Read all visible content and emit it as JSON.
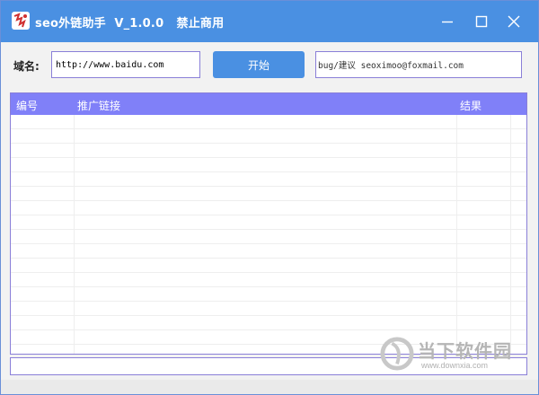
{
  "window": {
    "title": "seo外链助手  V_1.0.0   禁止商用",
    "accent_color": "#4a90e2",
    "controls": [
      "minimize-icon",
      "maximize-icon",
      "close-icon"
    ]
  },
  "form": {
    "domain_label": "域名:",
    "domain_value": "http://www.baidu.com",
    "start_label": "开始",
    "feedback_value": "bug/建议 seoximoo@foxmail.com"
  },
  "table": {
    "header_color": "#8080f8",
    "columns": [
      "编号",
      "推广链接",
      "结果"
    ],
    "rows": []
  },
  "watermark": {
    "name": "当下软件园",
    "url": "www.downxia.com"
  }
}
